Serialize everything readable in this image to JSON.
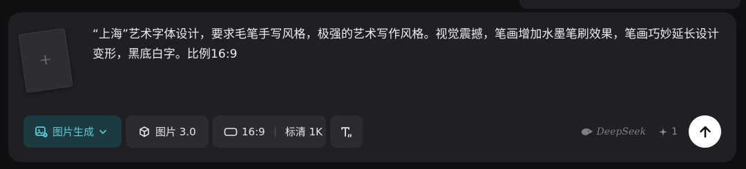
{
  "composer": {
    "upload_symbol": "+",
    "prompt_text": "“上海”艺术字体设计，要求毛笔手写风格，极强的艺术写作风格。视觉震撼，笔画增加水墨笔刷效果，笔画巧妙延长设计变形，黑底白字。比例16:9"
  },
  "toolbar": {
    "mode_label": "图片生成",
    "model_label": "图片 3.0",
    "ratio_label": "16:9",
    "quality_label": "标清 1K",
    "text_fx_icon": "text-effect-icon"
  },
  "footer": {
    "brand_label": "DeepSeek",
    "credits_value": "1",
    "send_icon": "arrow-up-icon"
  },
  "colors": {
    "accent": "#5ec9d7",
    "accent_bg": "#1d3a40",
    "panel": "#1f1f24",
    "chip": "#2b2c32",
    "send_bg": "#ffffff"
  }
}
